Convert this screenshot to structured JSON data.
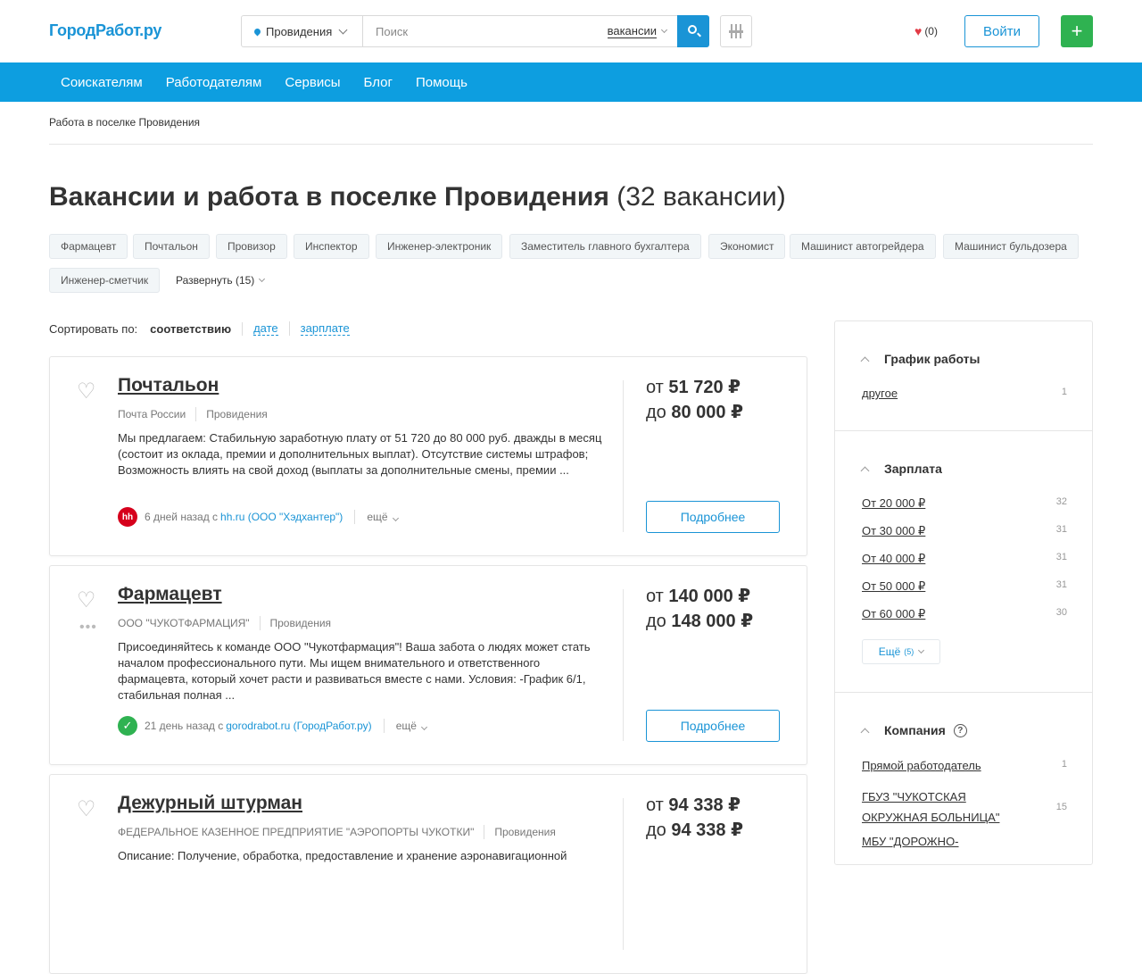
{
  "header": {
    "logo": "ГородРабот.ру",
    "location": "Провидения",
    "search_placeholder": "Поиск",
    "search_type": "вакансии",
    "favorites_count": "(0)",
    "login_label": "Войти",
    "add_label": "+"
  },
  "nav": [
    "Соискателям",
    "Работодателям",
    "Сервисы",
    "Блог",
    "Помощь"
  ],
  "breadcrumb": "Работа в поселке Провидения",
  "page_title": "Вакансии и работа в поселке Провидения",
  "page_count": "(32 вакансии)",
  "tags": [
    "Фармацевт",
    "Почтальон",
    "Провизор",
    "Инспектор",
    "Инженер-электроник",
    "Заместитель главного бухгалтера",
    "Экономист",
    "Машинист автогрейдера",
    "Машинист бульдозера",
    "Инженер-сметчик"
  ],
  "expand_label": "Развернуть (15)",
  "sort": {
    "label": "Сортировать по:",
    "current": "соответствию",
    "date": "дате",
    "salary": "зарплате"
  },
  "vacancies": [
    {
      "title": "Почтальон",
      "company": "Почта России",
      "city": "Провидения",
      "description": "Мы предлагаем: Стабильную заработную плату от 51 720 до 80 000 руб. дважды в месяц (состоит из оклада, премии и дополнительных выплат). Отсутствие системы штрафов; Возможность влиять на свой доход (выплаты за дополнительные смены, премии ...",
      "source_badge": "hh",
      "posted": "6 дней назад с",
      "source": "hh.ru (ООО \"Хэдхантер\")",
      "more": "ещё",
      "salary_from_label": "от",
      "salary_from": "51 720",
      "salary_to_label": "до",
      "salary_to": "80 000",
      "currency": "₽",
      "details": "Подробнее"
    },
    {
      "title": "Фармацевт",
      "company": "ООО \"ЧУКОТФАРМАЦИЯ\"",
      "city": "Провидения",
      "description": "Присоединяйтесь к команде ООО \"Чукотфармация\"! Ваша забота о людях может стать началом профессионального пути. Мы ищем внимательного и ответственного фармацевта, который хочет расти и развиваться вместе с нами. Условия: -График 6/1, стабильная полная ...",
      "source_badge": "✓",
      "posted": "21 день назад с",
      "source": "gorodrabot.ru (ГородРабот.ру)",
      "more": "ещё",
      "salary_from_label": "от",
      "salary_from": "140 000",
      "salary_to_label": "до",
      "salary_to": "148 000",
      "currency": "₽",
      "details": "Подробнее"
    },
    {
      "title": "Дежурный штурман",
      "company": "ФЕДЕРАЛЬНОЕ КАЗЕННОЕ ПРЕДПРИЯТИЕ \"АЭРОПОРТЫ ЧУКОТКИ\"",
      "city": "Провидения",
      "description": "Описание: Получение, обработка, предоставление и хранение аэронавигационной",
      "salary_from_label": "от",
      "salary_from": "94 338",
      "salary_to_label": "до",
      "salary_to": "94 338",
      "currency": "₽"
    }
  ],
  "sidebar": {
    "schedule": {
      "title": "График работы",
      "items": [
        {
          "label": "другое",
          "count": "1"
        }
      ]
    },
    "salary": {
      "title": "Зарплата",
      "items": [
        {
          "label": "От 20 000 ₽",
          "count": "32"
        },
        {
          "label": "От 30 000 ₽",
          "count": "31"
        },
        {
          "label": "От 40 000 ₽",
          "count": "31"
        },
        {
          "label": "От 50 000 ₽",
          "count": "31"
        },
        {
          "label": "От 60 000 ₽",
          "count": "30"
        }
      ],
      "more_label": "Ещё",
      "more_count": "(5)"
    },
    "company": {
      "title": "Компания",
      "items": [
        {
          "label": "Прямой работодатель",
          "count": "1"
        },
        {
          "label": "ГБУЗ \"ЧУКОТСКАЯ ОКРУЖНАЯ БОЛЬНИЦА\"",
          "count": "15"
        },
        {
          "label": "МБУ \"ДОРОЖНО-",
          "count": ""
        }
      ]
    }
  },
  "colors": {
    "brand": "#1a94d6",
    "nav": "#0d9ee0",
    "add": "#2fb251",
    "heart": "#e23b46"
  }
}
